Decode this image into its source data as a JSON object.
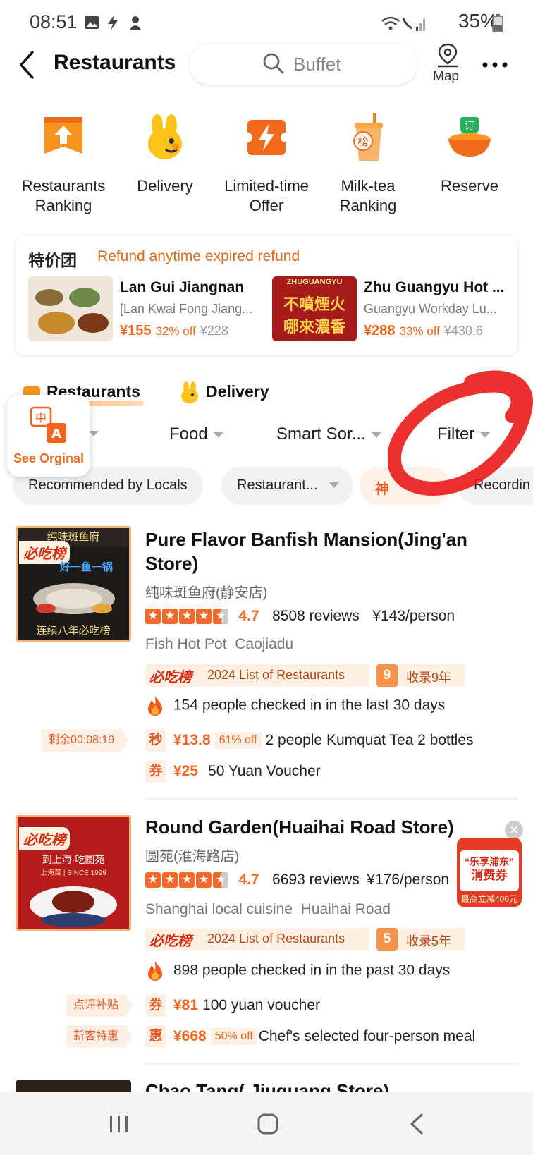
{
  "status": {
    "time": "08:51",
    "battery": "35%"
  },
  "header": {
    "title": "Restaurants",
    "search_placeholder": "Buffet",
    "map_label": "Map"
  },
  "categories": [
    {
      "label": "Restaurants Ranking"
    },
    {
      "label": "Delivery"
    },
    {
      "label": "Limited-time Offer"
    },
    {
      "label": "Milk-tea Ranking"
    },
    {
      "label": "Reserve"
    }
  ],
  "promo": {
    "brand": "特价团",
    "tagline": "Refund anytime expired refund",
    "deals": [
      {
        "name": "Lan Gui Jiangnan",
        "subtitle": "[Lan Kwai Fong Jiang...",
        "price": "¥155",
        "discount": "32% off",
        "original": "¥228"
      },
      {
        "name": "Zhu Guangyu Hot ...",
        "subtitle": "Guangyu Workday Lu...",
        "price": "¥288",
        "discount": "33% off",
        "original": "¥430.6",
        "img_text": "ZHUGUANGYU",
        "img_cn1": "不噴煙火",
        "img_cn2": "哪來濃香"
      }
    ]
  },
  "tabs": {
    "restaurants": "Restaurants",
    "delivery": "Delivery"
  },
  "filters": {
    "food": "Food",
    "sort": "Smart Sor...",
    "filter": "Filter"
  },
  "chips": [
    "Recommended by Locals",
    "Restaurant...",
    "神",
    "Recordin"
  ],
  "translate": {
    "label": "See Orginal"
  },
  "restaurants": [
    {
      "name": "Pure Flavor Banfish Mansion(Jing'an Store)",
      "name_cn": "纯味斑鱼府(静安店)",
      "score": "4.7",
      "reviews": "8508 reviews",
      "price_per_person": "¥143/person",
      "cuisine": "Fish Hot Pot",
      "area": "Caojiadu",
      "list_logo": "必吃榜",
      "list_label": "2024 List of Restaurants",
      "years_num": "9",
      "years_label": "收录9年",
      "checkins": "154 people checked in in the last 30 days",
      "thumb_top": "纯味斑鱼府",
      "thumb_mid": "好一鱼一锅",
      "thumb_bottom": "连续八年必吃榜",
      "offers": [
        {
          "side": "剩余00:08:19",
          "key": "秒",
          "price": "¥13.8",
          "off": "61% off",
          "desc": "2 people Kumquat Tea 2 bottles"
        },
        {
          "side": "",
          "key": "券",
          "price": "¥25",
          "off": "",
          "desc": "50 Yuan Voucher"
        }
      ]
    },
    {
      "name": "Round Garden(Huaihai Road Store)",
      "name_cn": "圆苑(淮海路店)",
      "score": "4.7",
      "reviews": "6693 reviews",
      "price_per_person": "¥176/person",
      "cuisine": "Shanghai local cuisine",
      "area": "Huaihai Road",
      "list_logo": "必吃榜",
      "list_label": "2024 List of Restaurants",
      "years_num": "5",
      "years_label": "收录5年",
      "checkins": "898 people checked in in the past 30 days",
      "thumb_top": "到上海·吃圆苑",
      "thumb_mid": "上海菜 | SINCE 1999",
      "offers": [
        {
          "side": "点评补贴",
          "key": "券",
          "price": "¥81",
          "off": "",
          "desc": "100 yuan voucher"
        },
        {
          "side": "新客特惠",
          "key": "惠",
          "price": "¥668",
          "off": "50% off",
          "desc": "Chef's selected four-person meal"
        }
      ]
    },
    {
      "name": "Chao Tang( Jiuguang Store)"
    }
  ],
  "coupon": {
    "line1": "“乐享浦东”",
    "line2": "消费券",
    "line3": "最高立减400元"
  },
  "colors": {
    "accent": "#f26a2b",
    "promo_text": "#d96a1e",
    "annotation": "#e8201e"
  }
}
